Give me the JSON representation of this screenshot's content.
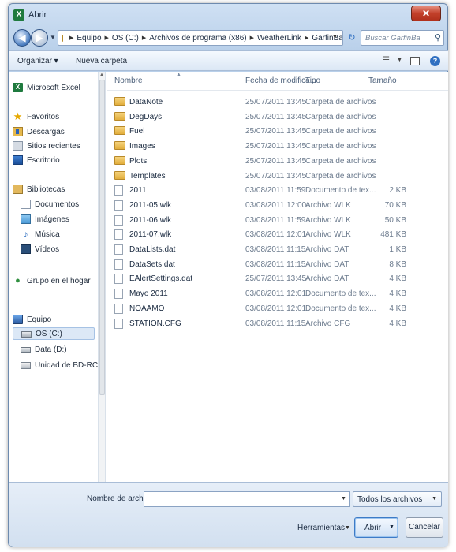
{
  "window": {
    "title": "Abrir",
    "app_icon_letter": "X",
    "close_glyph": "✕"
  },
  "nav": {
    "back_glyph": "◀",
    "forward_glyph": "▶",
    "breadcrumb": [
      "Equipo",
      "OS (C:)",
      "Archivos de programa (x86)",
      "WeatherLink",
      "GarfinBa"
    ],
    "search_placeholder": "Buscar GarfinBa",
    "search_icon": "⚲",
    "refresh_glyph": "↻"
  },
  "toolbar": {
    "organize": "Organizar ▾",
    "new_folder": "Nueva carpeta",
    "views_glyph": "☰",
    "help_glyph": "?"
  },
  "sidebar": {
    "items": [
      {
        "label": "Microsoft Excel",
        "icon": "excel-icon"
      },
      {
        "label": "Favoritos",
        "icon": "star-icon"
      },
      {
        "label": "Descargas",
        "icon": "downloads-icon"
      },
      {
        "label": "Sitios recientes",
        "icon": "recent-places-icon"
      },
      {
        "label": "Escritorio",
        "icon": "desktop-icon"
      },
      {
        "label": "Bibliotecas",
        "icon": "libraries-icon"
      },
      {
        "label": "Documentos",
        "icon": "documents-icon"
      },
      {
        "label": "Imágenes",
        "icon": "pictures-icon"
      },
      {
        "label": "Música",
        "icon": "music-icon"
      },
      {
        "label": "Vídeos",
        "icon": "videos-icon"
      },
      {
        "label": "Grupo en el hogar",
        "icon": "homegroup-icon"
      },
      {
        "label": "Equipo",
        "icon": "computer-icon"
      },
      {
        "label": "OS (C:)",
        "icon": "drive-icon"
      },
      {
        "label": "Data (D:)",
        "icon": "drive-icon"
      },
      {
        "label": "Unidad de BD-RC",
        "icon": "bd-drive-icon"
      }
    ]
  },
  "columns": {
    "name": "Nombre",
    "date": "Fecha de modifica...",
    "type": "Tipo",
    "size": "Tamaño"
  },
  "files": [
    {
      "name": "DataNote",
      "date": "25/07/2011 13:45",
      "type": "Carpeta de archivos",
      "size": "",
      "kind": "folder"
    },
    {
      "name": "DegDays",
      "date": "25/07/2011 13:45",
      "type": "Carpeta de archivos",
      "size": "",
      "kind": "folder"
    },
    {
      "name": "Fuel",
      "date": "25/07/2011 13:45",
      "type": "Carpeta de archivos",
      "size": "",
      "kind": "folder"
    },
    {
      "name": "Images",
      "date": "25/07/2011 13:45",
      "type": "Carpeta de archivos",
      "size": "",
      "kind": "folder"
    },
    {
      "name": "Plots",
      "date": "25/07/2011 13:45",
      "type": "Carpeta de archivos",
      "size": "",
      "kind": "folder"
    },
    {
      "name": "Templates",
      "date": "25/07/2011 13:45",
      "type": "Carpeta de archivos",
      "size": "",
      "kind": "folder"
    },
    {
      "name": "2011",
      "date": "03/08/2011 11:59",
      "type": "Documento de tex...",
      "size": "2 KB",
      "kind": "file"
    },
    {
      "name": "2011-05.wlk",
      "date": "03/08/2011 12:00",
      "type": "Archivo WLK",
      "size": "70 KB",
      "kind": "file"
    },
    {
      "name": "2011-06.wlk",
      "date": "03/08/2011 11:59",
      "type": "Archivo WLK",
      "size": "50 KB",
      "kind": "file"
    },
    {
      "name": "2011-07.wlk",
      "date": "03/08/2011 12:01",
      "type": "Archivo WLK",
      "size": "481 KB",
      "kind": "file"
    },
    {
      "name": "DataLists.dat",
      "date": "03/08/2011 11:15",
      "type": "Archivo DAT",
      "size": "1 KB",
      "kind": "file"
    },
    {
      "name": "DataSets.dat",
      "date": "03/08/2011 11:15",
      "type": "Archivo DAT",
      "size": "8 KB",
      "kind": "file"
    },
    {
      "name": "EAlertSettings.dat",
      "date": "25/07/2011 13:45",
      "type": "Archivo DAT",
      "size": "4 KB",
      "kind": "file"
    },
    {
      "name": "Mayo 2011",
      "date": "03/08/2011 12:01",
      "type": "Documento de tex...",
      "size": "4 KB",
      "kind": "file"
    },
    {
      "name": "NOAAMO",
      "date": "03/08/2011 12:01",
      "type": "Documento de tex...",
      "size": "4 KB",
      "kind": "file"
    },
    {
      "name": "STATION.CFG",
      "date": "03/08/2011 11:15",
      "type": "Archivo CFG",
      "size": "4 KB",
      "kind": "file"
    }
  ],
  "footer": {
    "filename_label": "Nombre de archivo:",
    "filename_value": "",
    "filetype_selected": "Todos los archivos",
    "tools_label": "Herramientas",
    "open_label": "Abrir",
    "cancel_label": "Cancelar"
  }
}
